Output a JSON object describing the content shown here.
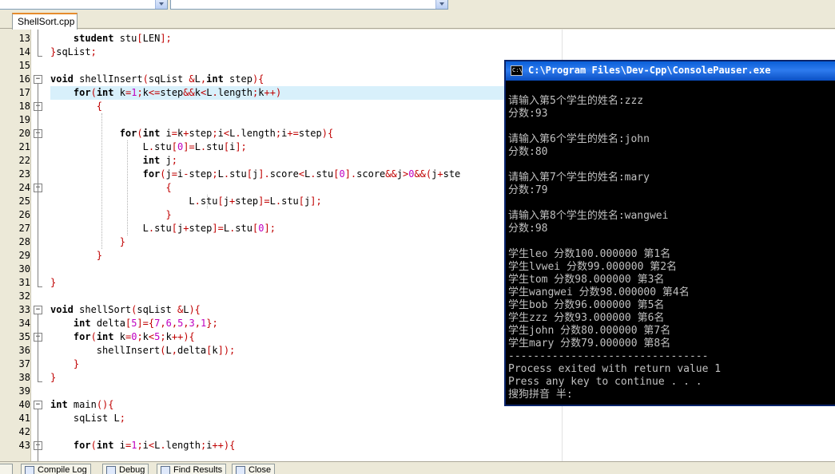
{
  "editor": {
    "tab_label": "ShellSort.cpp",
    "lines": [
      {
        "n": "13",
        "code": "    student stu[LEN];"
      },
      {
        "n": "14",
        "code": "}sqList;"
      },
      {
        "n": "15",
        "code": ""
      },
      {
        "n": "16",
        "code": "void shellInsert(sqList &L,int step){"
      },
      {
        "n": "17",
        "code": "    for(int k=1;k<=step&&k<L.length;k++)"
      },
      {
        "n": "18",
        "code": "        {"
      },
      {
        "n": "19",
        "code": ""
      },
      {
        "n": "20",
        "code": "            for(int i=k+step;i<L.length;i+=step){"
      },
      {
        "n": "21",
        "code": "                L.stu[0]=L.stu[i];"
      },
      {
        "n": "22",
        "code": "                int j;"
      },
      {
        "n": "23",
        "code": "                for(j=i-step;L.stu[j].score<L.stu[0].score&&j>0&&(j+ste"
      },
      {
        "n": "24",
        "code": "                    {"
      },
      {
        "n": "25",
        "code": "                        L.stu[j+step]=L.stu[j];"
      },
      {
        "n": "26",
        "code": "                    }"
      },
      {
        "n": "27",
        "code": "                L.stu[j+step]=L.stu[0];"
      },
      {
        "n": "28",
        "code": "            }"
      },
      {
        "n": "29",
        "code": "        }"
      },
      {
        "n": "30",
        "code": ""
      },
      {
        "n": "31",
        "code": "}"
      },
      {
        "n": "32",
        "code": ""
      },
      {
        "n": "33",
        "code": "void shellSort(sqList &L){"
      },
      {
        "n": "34",
        "code": "    int delta[5]={7,6,5,3,1};"
      },
      {
        "n": "35",
        "code": "    for(int k=0;k<5;k++){"
      },
      {
        "n": "36",
        "code": "        shellInsert(L,delta[k]);"
      },
      {
        "n": "37",
        "code": "    }"
      },
      {
        "n": "38",
        "code": "}"
      },
      {
        "n": "39",
        "code": ""
      },
      {
        "n": "40",
        "code": "int main(){"
      },
      {
        "n": "41",
        "code": "    sqList L;"
      },
      {
        "n": "42",
        "code": ""
      },
      {
        "n": "43",
        "code": "    for(int i=1;i<L.length;i++){"
      }
    ]
  },
  "console": {
    "title": "C:\\Program Files\\Dev-Cpp\\ConsolePauser.exe",
    "icon_label": "C:\\",
    "lines": [
      "",
      "请输入第5个学生的姓名:zzz",
      "分数:93",
      "",
      "请输入第6个学生的姓名:john",
      "分数:80",
      "",
      "请输入第7个学生的姓名:mary",
      "分数:79",
      "",
      "请输入第8个学生的姓名:wangwei",
      "分数:98",
      "",
      "学生leo 分数100.000000 第1名",
      "学生lvwei 分数99.000000 第2名",
      "学生tom 分数98.000000 第3名",
      "学生wangwei 分数98.000000 第4名",
      "学生bob 分数96.000000 第5名",
      "学生zzz 分数93.000000 第6名",
      "学生john 分数80.000000 第7名",
      "学生mary 分数79.000000 第8名",
      "--------------------------------",
      "Process exited with return value 1",
      "Press any key to continue . . .",
      "搜狗拼音 半:"
    ]
  },
  "bottom_tabs": [
    {
      "label": "Compile Log",
      "icon": "compile-log-icon"
    },
    {
      "label": "Debug",
      "icon": "debug-icon"
    },
    {
      "label": "Find Results",
      "icon": "find-results-icon"
    },
    {
      "label": "Close",
      "icon": "close-icon"
    }
  ],
  "colors": {
    "symbol": "#c00000",
    "number": "#c000c0",
    "current_line": "#d8f0fb",
    "console_bg": "#000000",
    "console_text": "#c0c0c0",
    "titlebar": "#0a5fd8"
  }
}
